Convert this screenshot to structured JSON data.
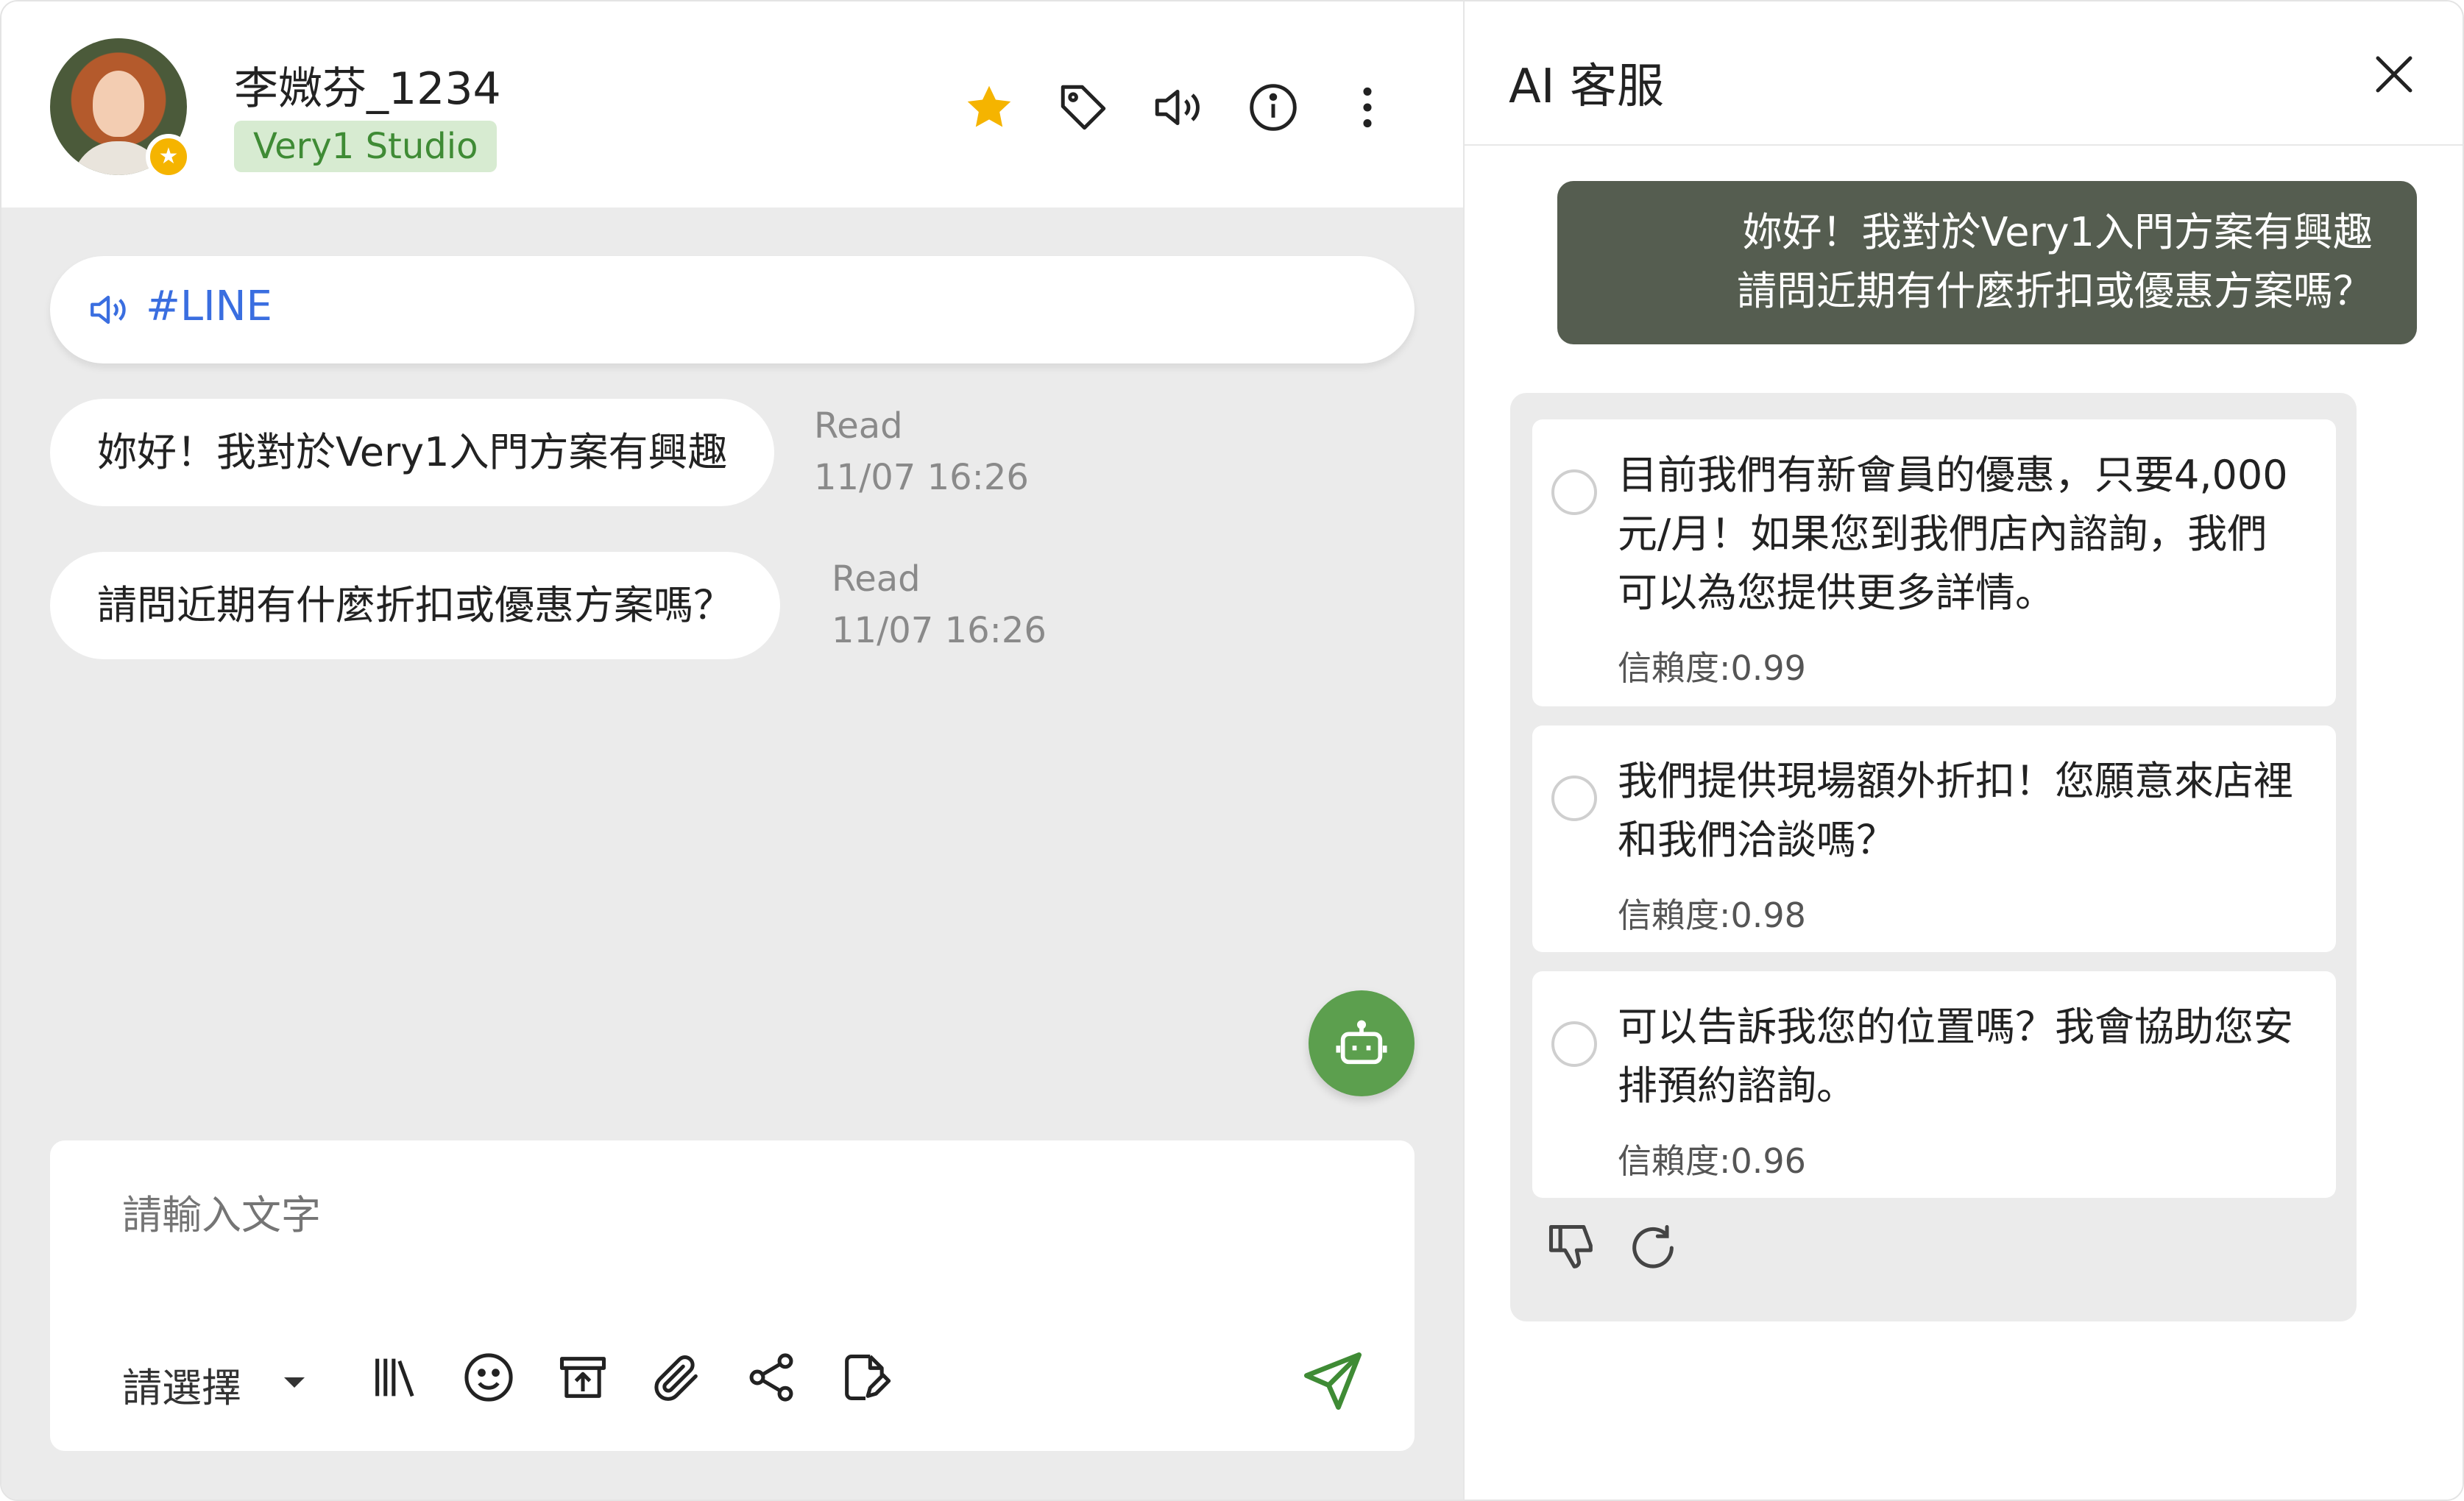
{
  "contact": {
    "name": "李媺芬_1234",
    "tag": "Very1 Studio"
  },
  "header_icons": [
    "star-icon",
    "tag-icon",
    "speaker-icon",
    "info-icon",
    "more-vertical-icon"
  ],
  "colors": {
    "star": "#f5b400",
    "channel_text": "#3a6ee0",
    "brand_green": "#5c9f4e",
    "tag_bg": "#d7ebd1",
    "tag_text": "#3f8b35",
    "user_bubble": "#555d50"
  },
  "channel": {
    "label": "#LINE"
  },
  "messages": [
    {
      "text": "妳好！我對於Very1入門方案有興趣",
      "status": "Read",
      "time": "11/07 16:26"
    },
    {
      "text": "請問近期有什麼折扣或優惠方案嗎？",
      "status": "Read",
      "time": "11/07 16:26"
    }
  ],
  "composer": {
    "placeholder": "請輸入文字",
    "select_label": "請選擇",
    "tools": [
      "library-icon",
      "emoji-icon",
      "archive-upload-icon",
      "paperclip-icon",
      "share-icon",
      "note-edit-icon"
    ]
  },
  "ai_panel": {
    "title": "AI 客服",
    "user_message_line1": "妳好！我對於Very1入門方案有興趣",
    "user_message_line2": "請問近期有什麼折扣或優惠方案嗎？",
    "suggestions": [
      {
        "text": "目前我們有新會員的優惠，只要4,000元/月！如果您到我們店內諮詢，我們可以為您提供更多詳情。",
        "confidence": "信賴度:0.99"
      },
      {
        "text": "我們提供現場額外折扣！您願意來店裡和我們洽談嗎？",
        "confidence": "信賴度:0.98"
      },
      {
        "text": "可以告訴我您的位置嗎？我會協助您安排預約諮詢。",
        "confidence": "信賴度:0.96"
      }
    ]
  }
}
